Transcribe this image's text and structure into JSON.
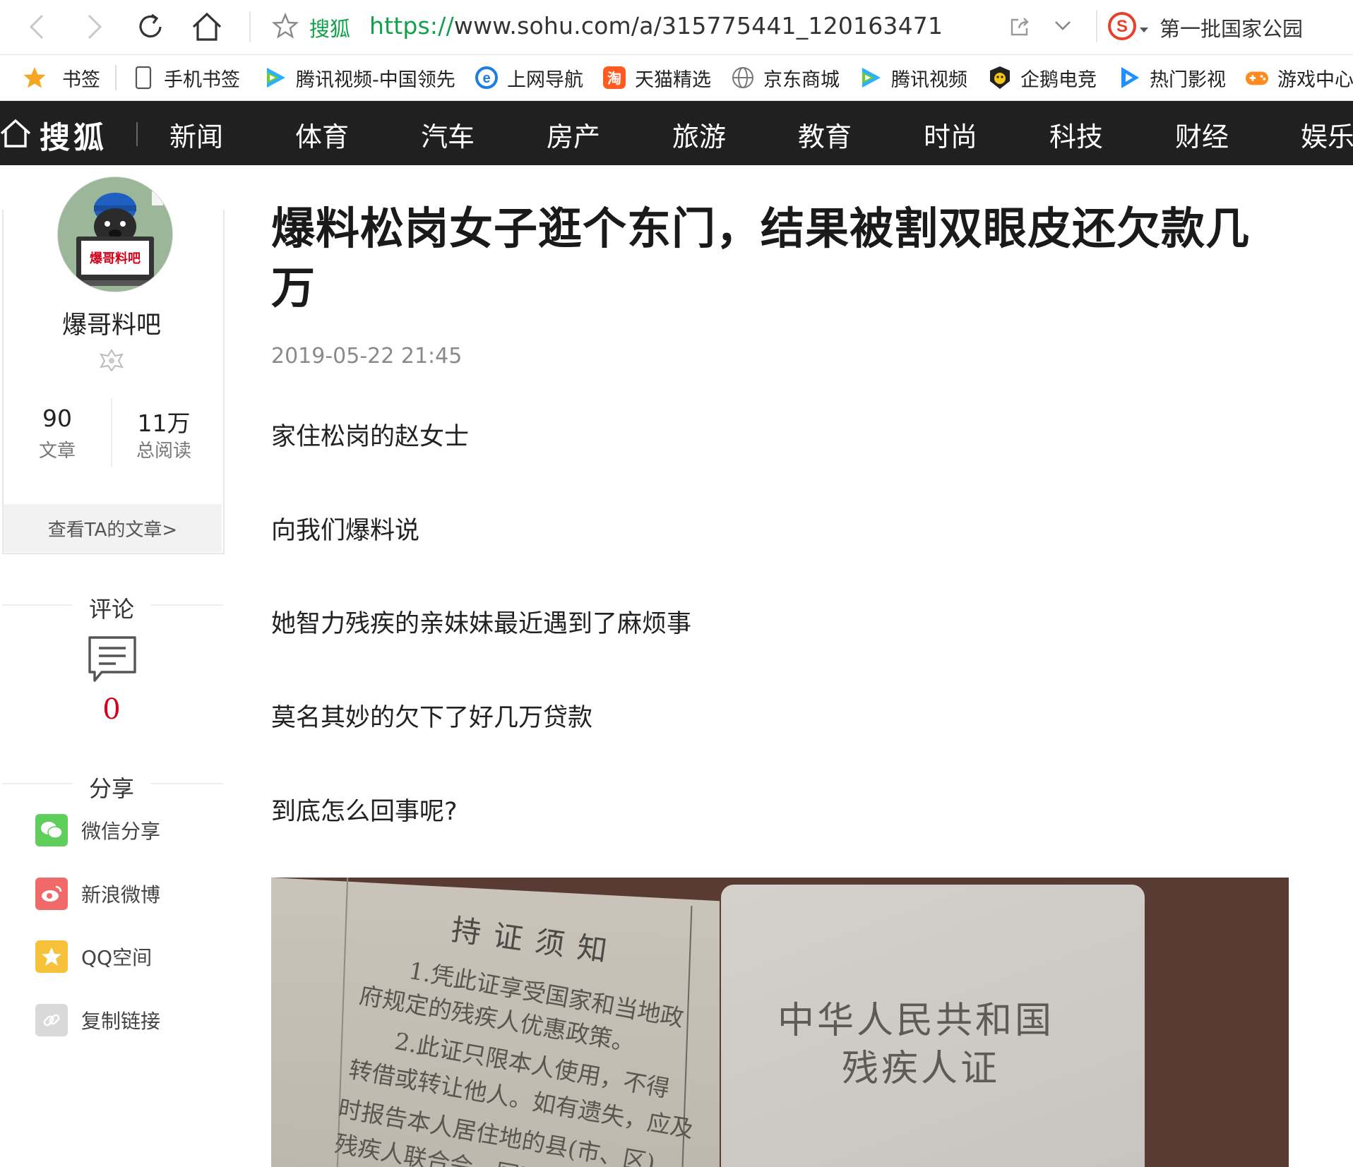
{
  "browser": {
    "site_name": "搜狐",
    "url_protocol": "https://",
    "url_rest": "www.sohu.com/a/315775441_120163471",
    "search_query": "第一批国家公园"
  },
  "bookmarks": [
    {
      "label": "书签",
      "icon": "star-icon"
    },
    {
      "label": "手机书签",
      "icon": "phone-icon"
    },
    {
      "label": "腾讯视频-中国领先",
      "icon": "tencent-video-icon"
    },
    {
      "label": "上网导航",
      "icon": "ie-icon"
    },
    {
      "label": "天猫精选",
      "icon": "taobao-icon"
    },
    {
      "label": "京东商城",
      "icon": "globe-icon"
    },
    {
      "label": "腾讯视频",
      "icon": "tencent-video-icon"
    },
    {
      "label": "企鹅电竞",
      "icon": "penguin-esports-icon"
    },
    {
      "label": "热门影视",
      "icon": "play-icon"
    },
    {
      "label": "游戏中心",
      "icon": "gamepad-icon"
    }
  ],
  "nav": {
    "logo": "搜狐",
    "items": [
      "新闻",
      "体育",
      "汽车",
      "房产",
      "旅游",
      "教育",
      "时尚",
      "科技",
      "财经",
      "娱乐"
    ]
  },
  "author": {
    "avatar_text": "爆哥料吧",
    "name": "爆哥料吧",
    "articles_count": "90",
    "articles_label": "文章",
    "reads_count": "11万",
    "reads_label": "总阅读",
    "view_articles": "查看TA的文章>"
  },
  "comments": {
    "title": "评论",
    "count": "0"
  },
  "share": {
    "title": "分享",
    "items": [
      {
        "label": "微信分享",
        "icon": "wechat-icon",
        "color": "#5fce5a"
      },
      {
        "label": "新浪微博",
        "icon": "weibo-icon",
        "color": "#f06a6a"
      },
      {
        "label": "QQ空间",
        "icon": "qzone-icon",
        "color": "#f7c23a"
      },
      {
        "label": "复制链接",
        "icon": "link-icon",
        "color": "#d9d9d9"
      }
    ]
  },
  "article": {
    "title": "爆料松岗女子逛个东门，结果被割双眼皮还欠款几万",
    "date": "2019-05-22 21:45",
    "paragraphs": [
      "家住松岗的赵女士",
      "向我们爆料说",
      "她智力残疾的亲妹妹最近遇到了麻烦事",
      "莫名其妙的欠下了好几万贷款",
      "到底怎么回事呢?"
    ],
    "image": {
      "left_title": "持证须知",
      "left_lines": [
        "1.凭此证享受国家和当地政",
        "府规定的残疾人优惠政策。",
        "2.此证只限本人使用，不得",
        "转借或转让他人。如有遗失，应及",
        "时报告本人居住地的县(市、区)",
        "残疾人联合会，同时声明"
      ],
      "right_line1": "中华人民共和国",
      "right_line2": "残疾人证"
    }
  },
  "colors": {
    "brand_green": "#11a04b",
    "nav_bg": "#202021",
    "accent_red": "#d0021b"
  }
}
